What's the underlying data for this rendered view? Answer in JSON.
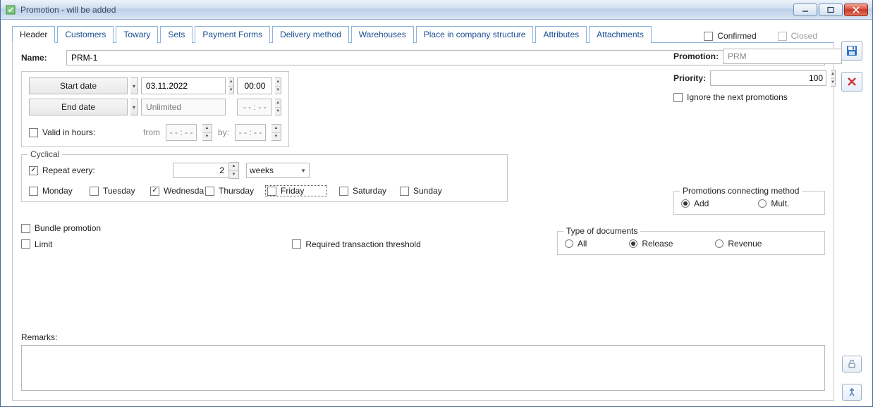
{
  "window": {
    "title": "Promotion - will be added"
  },
  "tabs": [
    {
      "label": "Header"
    },
    {
      "label": "Customers"
    },
    {
      "label": "Towary"
    },
    {
      "label": "Sets"
    },
    {
      "label": "Payment Forms"
    },
    {
      "label": "Delivery method"
    },
    {
      "label": "Warehouses"
    },
    {
      "label": "Place in company structure"
    },
    {
      "label": "Attributes"
    },
    {
      "label": "Attachments"
    }
  ],
  "status": {
    "confirmed_label": "Confirmed",
    "closed_label": "Closed"
  },
  "header": {
    "name_label": "Name:",
    "name_value": "PRM-1",
    "start_date_btn": "Start date",
    "end_date_btn": "End date",
    "start_date_value": "03.11.2022",
    "end_date_placeholder": "Unlimited",
    "start_time_value": "00:00",
    "end_time_placeholder": "- - : - -",
    "valid_in_hours_label": "Valid in hours:",
    "from_label": "from",
    "by_label": "by:",
    "from_value": "- - : - -",
    "by_value": "- - : - -"
  },
  "cyclical": {
    "legend": "Cyclical",
    "repeat_label": "Repeat every:",
    "repeat_value": "2",
    "repeat_unit": "weeks",
    "days": {
      "mon": "Monday",
      "tue": "Tuesday",
      "wed": "Wednesda",
      "thu": "Thursday",
      "fri": "Friday",
      "sat": "Saturday",
      "sun": "Sunday"
    }
  },
  "options": {
    "bundle_label": "Bundle promotion",
    "limit_label": "Limit",
    "threshold_label": "Required transaction threshold"
  },
  "right": {
    "promotion_label": "Promotion:",
    "promotion_value": "PRM",
    "priority_label": "Priority:",
    "priority_value": "100",
    "ignore_label": "Ignore the next promotions"
  },
  "connecting": {
    "legend": "Promotions connecting method",
    "add": "Add",
    "mult": "Mult."
  },
  "doc_type": {
    "legend": "Type of documents",
    "all": "All",
    "release": "Release",
    "revenue": "Revenue"
  },
  "remarks": {
    "label": "Remarks:"
  },
  "chart_data": null
}
